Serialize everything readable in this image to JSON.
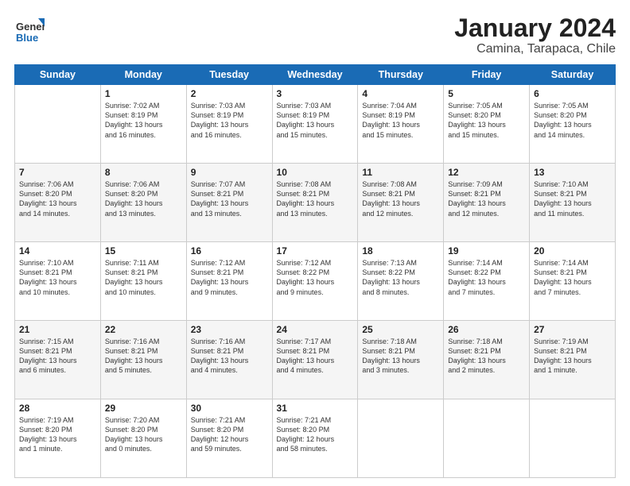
{
  "header": {
    "logo_general": "General",
    "logo_blue": "Blue",
    "title": "January 2024",
    "location": "Camina, Tarapaca, Chile"
  },
  "days_of_week": [
    "Sunday",
    "Monday",
    "Tuesday",
    "Wednesday",
    "Thursday",
    "Friday",
    "Saturday"
  ],
  "weeks": [
    [
      {
        "day": "",
        "sunrise": "",
        "sunset": "",
        "daylight": "",
        "daylight2": ""
      },
      {
        "day": "1",
        "sunrise": "Sunrise: 7:02 AM",
        "sunset": "Sunset: 8:19 PM",
        "daylight": "Daylight: 13 hours",
        "daylight2": "and 16 minutes."
      },
      {
        "day": "2",
        "sunrise": "Sunrise: 7:03 AM",
        "sunset": "Sunset: 8:19 PM",
        "daylight": "Daylight: 13 hours",
        "daylight2": "and 16 minutes."
      },
      {
        "day": "3",
        "sunrise": "Sunrise: 7:03 AM",
        "sunset": "Sunset: 8:19 PM",
        "daylight": "Daylight: 13 hours",
        "daylight2": "and 15 minutes."
      },
      {
        "day": "4",
        "sunrise": "Sunrise: 7:04 AM",
        "sunset": "Sunset: 8:19 PM",
        "daylight": "Daylight: 13 hours",
        "daylight2": "and 15 minutes."
      },
      {
        "day": "5",
        "sunrise": "Sunrise: 7:05 AM",
        "sunset": "Sunset: 8:20 PM",
        "daylight": "Daylight: 13 hours",
        "daylight2": "and 15 minutes."
      },
      {
        "day": "6",
        "sunrise": "Sunrise: 7:05 AM",
        "sunset": "Sunset: 8:20 PM",
        "daylight": "Daylight: 13 hours",
        "daylight2": "and 14 minutes."
      }
    ],
    [
      {
        "day": "7",
        "sunrise": "Sunrise: 7:06 AM",
        "sunset": "Sunset: 8:20 PM",
        "daylight": "Daylight: 13 hours",
        "daylight2": "and 14 minutes."
      },
      {
        "day": "8",
        "sunrise": "Sunrise: 7:06 AM",
        "sunset": "Sunset: 8:20 PM",
        "daylight": "Daylight: 13 hours",
        "daylight2": "and 13 minutes."
      },
      {
        "day": "9",
        "sunrise": "Sunrise: 7:07 AM",
        "sunset": "Sunset: 8:21 PM",
        "daylight": "Daylight: 13 hours",
        "daylight2": "and 13 minutes."
      },
      {
        "day": "10",
        "sunrise": "Sunrise: 7:08 AM",
        "sunset": "Sunset: 8:21 PM",
        "daylight": "Daylight: 13 hours",
        "daylight2": "and 13 minutes."
      },
      {
        "day": "11",
        "sunrise": "Sunrise: 7:08 AM",
        "sunset": "Sunset: 8:21 PM",
        "daylight": "Daylight: 13 hours",
        "daylight2": "and 12 minutes."
      },
      {
        "day": "12",
        "sunrise": "Sunrise: 7:09 AM",
        "sunset": "Sunset: 8:21 PM",
        "daylight": "Daylight: 13 hours",
        "daylight2": "and 12 minutes."
      },
      {
        "day": "13",
        "sunrise": "Sunrise: 7:10 AM",
        "sunset": "Sunset: 8:21 PM",
        "daylight": "Daylight: 13 hours",
        "daylight2": "and 11 minutes."
      }
    ],
    [
      {
        "day": "14",
        "sunrise": "Sunrise: 7:10 AM",
        "sunset": "Sunset: 8:21 PM",
        "daylight": "Daylight: 13 hours",
        "daylight2": "and 10 minutes."
      },
      {
        "day": "15",
        "sunrise": "Sunrise: 7:11 AM",
        "sunset": "Sunset: 8:21 PM",
        "daylight": "Daylight: 13 hours",
        "daylight2": "and 10 minutes."
      },
      {
        "day": "16",
        "sunrise": "Sunrise: 7:12 AM",
        "sunset": "Sunset: 8:21 PM",
        "daylight": "Daylight: 13 hours",
        "daylight2": "and 9 minutes."
      },
      {
        "day": "17",
        "sunrise": "Sunrise: 7:12 AM",
        "sunset": "Sunset: 8:22 PM",
        "daylight": "Daylight: 13 hours",
        "daylight2": "and 9 minutes."
      },
      {
        "day": "18",
        "sunrise": "Sunrise: 7:13 AM",
        "sunset": "Sunset: 8:22 PM",
        "daylight": "Daylight: 13 hours",
        "daylight2": "and 8 minutes."
      },
      {
        "day": "19",
        "sunrise": "Sunrise: 7:14 AM",
        "sunset": "Sunset: 8:22 PM",
        "daylight": "Daylight: 13 hours",
        "daylight2": "and 7 minutes."
      },
      {
        "day": "20",
        "sunrise": "Sunrise: 7:14 AM",
        "sunset": "Sunset: 8:21 PM",
        "daylight": "Daylight: 13 hours",
        "daylight2": "and 7 minutes."
      }
    ],
    [
      {
        "day": "21",
        "sunrise": "Sunrise: 7:15 AM",
        "sunset": "Sunset: 8:21 PM",
        "daylight": "Daylight: 13 hours",
        "daylight2": "and 6 minutes."
      },
      {
        "day": "22",
        "sunrise": "Sunrise: 7:16 AM",
        "sunset": "Sunset: 8:21 PM",
        "daylight": "Daylight: 13 hours",
        "daylight2": "and 5 minutes."
      },
      {
        "day": "23",
        "sunrise": "Sunrise: 7:16 AM",
        "sunset": "Sunset: 8:21 PM",
        "daylight": "Daylight: 13 hours",
        "daylight2": "and 4 minutes."
      },
      {
        "day": "24",
        "sunrise": "Sunrise: 7:17 AM",
        "sunset": "Sunset: 8:21 PM",
        "daylight": "Daylight: 13 hours",
        "daylight2": "and 4 minutes."
      },
      {
        "day": "25",
        "sunrise": "Sunrise: 7:18 AM",
        "sunset": "Sunset: 8:21 PM",
        "daylight": "Daylight: 13 hours",
        "daylight2": "and 3 minutes."
      },
      {
        "day": "26",
        "sunrise": "Sunrise: 7:18 AM",
        "sunset": "Sunset: 8:21 PM",
        "daylight": "Daylight: 13 hours",
        "daylight2": "and 2 minutes."
      },
      {
        "day": "27",
        "sunrise": "Sunrise: 7:19 AM",
        "sunset": "Sunset: 8:21 PM",
        "daylight": "Daylight: 13 hours",
        "daylight2": "and 1 minute."
      }
    ],
    [
      {
        "day": "28",
        "sunrise": "Sunrise: 7:19 AM",
        "sunset": "Sunset: 8:20 PM",
        "daylight": "Daylight: 13 hours",
        "daylight2": "and 1 minute."
      },
      {
        "day": "29",
        "sunrise": "Sunrise: 7:20 AM",
        "sunset": "Sunset: 8:20 PM",
        "daylight": "Daylight: 13 hours",
        "daylight2": "and 0 minutes."
      },
      {
        "day": "30",
        "sunrise": "Sunrise: 7:21 AM",
        "sunset": "Sunset: 8:20 PM",
        "daylight": "Daylight: 12 hours",
        "daylight2": "and 59 minutes."
      },
      {
        "day": "31",
        "sunrise": "Sunrise: 7:21 AM",
        "sunset": "Sunset: 8:20 PM",
        "daylight": "Daylight: 12 hours",
        "daylight2": "and 58 minutes."
      },
      {
        "day": "",
        "sunrise": "",
        "sunset": "",
        "daylight": "",
        "daylight2": ""
      },
      {
        "day": "",
        "sunrise": "",
        "sunset": "",
        "daylight": "",
        "daylight2": ""
      },
      {
        "day": "",
        "sunrise": "",
        "sunset": "",
        "daylight": "",
        "daylight2": ""
      }
    ]
  ]
}
